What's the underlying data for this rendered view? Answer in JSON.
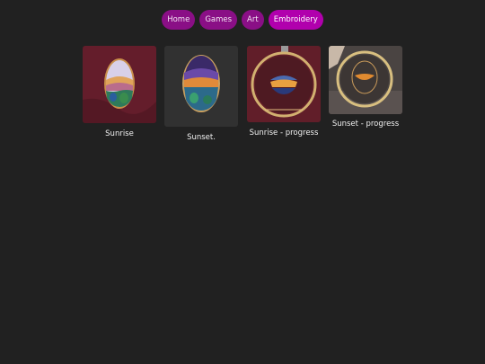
{
  "nav": {
    "items": [
      {
        "label": "Home"
      },
      {
        "label": "Games"
      },
      {
        "label": "Art"
      },
      {
        "label": "Embroidery"
      }
    ],
    "active": "Embroidery"
  },
  "gallery": {
    "items": [
      {
        "caption": "Sunrise"
      },
      {
        "caption": "Sunset."
      },
      {
        "caption": "Sunrise - progress"
      },
      {
        "caption": "Sunset - progress"
      }
    ]
  },
  "colors": {
    "background": "#212121",
    "nav_button": "#8a0f86",
    "nav_button_active": "#b100ad",
    "text": "#f2f2f2"
  }
}
